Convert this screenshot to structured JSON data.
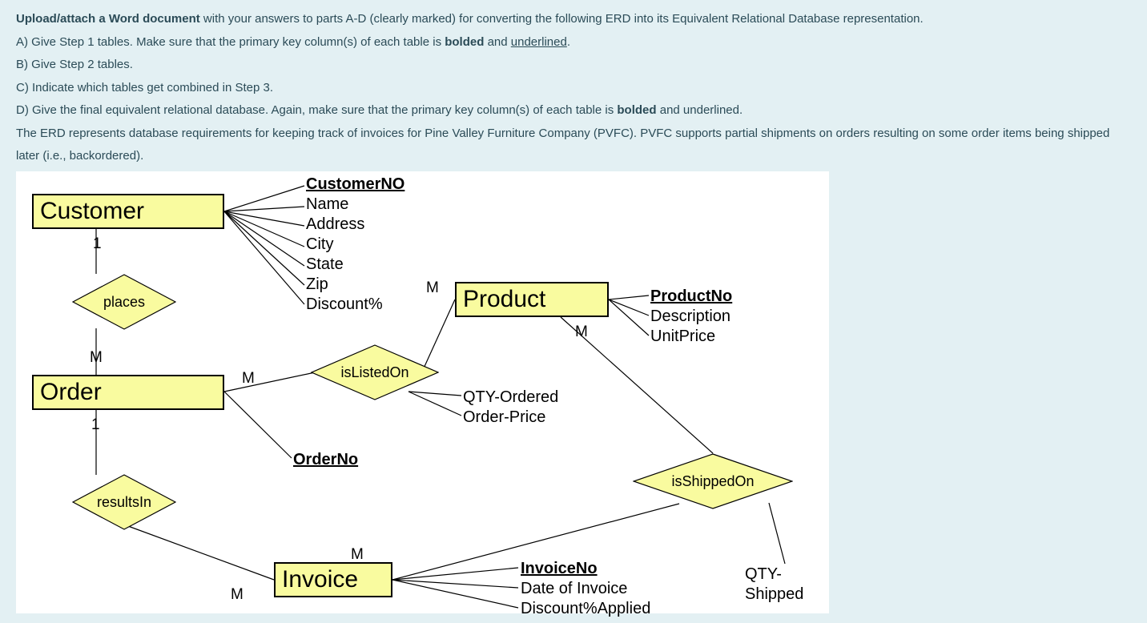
{
  "instructions": {
    "lead_bold": "Upload/attach a Word document",
    "lead_rest": " with your answers to parts A-D (clearly marked) for converting the following ERD into its Equivalent Relational Database representation.",
    "a_pre": "A) Give Step 1 tables. Make sure that the primary key column(s) of each table is ",
    "a_bold": "bolded",
    "a_and": " and ",
    "a_under": "underlined",
    "a_post": ".",
    "b": "B) Give Step 2 tables.",
    "c": "C) Indicate which tables get combined in Step 3.",
    "d_pre": "D) Give the final equivalent relational database. Again, make sure that the primary key column(s) of each table is ",
    "d_bold": "bolded",
    "d_and": " and underlined.",
    "context": "The ERD represents database requirements for keeping track of invoices for Pine Valley Furniture Company (PVFC). PVFC supports partial shipments on orders resulting on some order items being shipped later (i.e., backordered)."
  },
  "entities": {
    "customer": "Customer",
    "order": "Order",
    "product": "Product",
    "invoice": "Invoice"
  },
  "relations": {
    "places": "places",
    "resultsIn": "resultsIn",
    "isListedOn": "isListedOn",
    "isShippedOn": "isShippedOn"
  },
  "attrs": {
    "customer": {
      "pk": "CustomerNO",
      "a1": "Name",
      "a2": "Address",
      "a3": "City",
      "a4": "State",
      "a5": "Zip",
      "a6": "Discount%"
    },
    "order": {
      "pk": "OrderNo"
    },
    "product": {
      "pk": "ProductNo",
      "a1": "Description",
      "a2": "UnitPrice"
    },
    "invoice": {
      "pk": "InvoiceNo",
      "a1": "Date of Invoice",
      "a2": "Discount%Applied"
    },
    "isListedOn": {
      "a1": "QTY-Ordered",
      "a2": "Order-Price"
    },
    "isShippedOn": {
      "a1": "QTY-Shipped"
    }
  },
  "cards": {
    "cust_1": "1",
    "places_M": "M",
    "order_1": "1",
    "resultsIn_M": "M",
    "order_M": "M",
    "product_M_listed": "M",
    "product_M_shipped": "M",
    "invoice_M": "M"
  }
}
